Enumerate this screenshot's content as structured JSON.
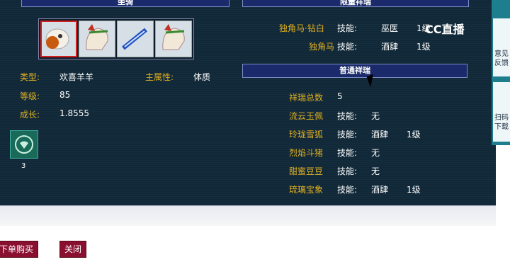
{
  "mount_section": {
    "title": "坐骑"
  },
  "mount_info": {
    "type_label": "类型:",
    "type_value": "欢喜羊羊",
    "attr_label": "主属性:",
    "attr_value": "体质",
    "level_label": "等级:",
    "level_value": "85",
    "growth_label": "成长:",
    "growth_value": "1.8555",
    "badge_count": "3"
  },
  "limited_section": {
    "title": "限量祥瑞",
    "items": [
      {
        "name": "独角马·钻白",
        "skill_label": "技能:",
        "skill": "巫医",
        "level": "1级"
      },
      {
        "name": "独角马",
        "skill_label": "技能:",
        "skill": "酒肆",
        "level": "1级"
      }
    ]
  },
  "normal_section": {
    "title": "普通祥瑞",
    "total_label": "祥瑞总数",
    "total_value": "5",
    "items": [
      {
        "name": "流云玉佩",
        "skill_label": "技能:",
        "skill": "无",
        "level": ""
      },
      {
        "name": "玲珑雪狐",
        "skill_label": "技能:",
        "skill": "酒肆",
        "level": "1级"
      },
      {
        "name": "烈焰斗猪",
        "skill_label": "技能:",
        "skill": "无",
        "level": ""
      },
      {
        "name": "甜蜜豆豆",
        "skill_label": "技能:",
        "skill": "无",
        "level": ""
      },
      {
        "name": "琉璃宝象",
        "skill_label": "技能:",
        "skill": "酒肆",
        "level": "1级"
      }
    ]
  },
  "buttons": {
    "buy": "下单购买",
    "close": "关闭"
  },
  "overlay": {
    "logo": "CC直播",
    "side_1": "意见反馈",
    "side_2": "扫码下载"
  },
  "colors": {
    "panel_bg": "#102838",
    "gold": "#e0b020",
    "button_bg": "#8a1030"
  }
}
